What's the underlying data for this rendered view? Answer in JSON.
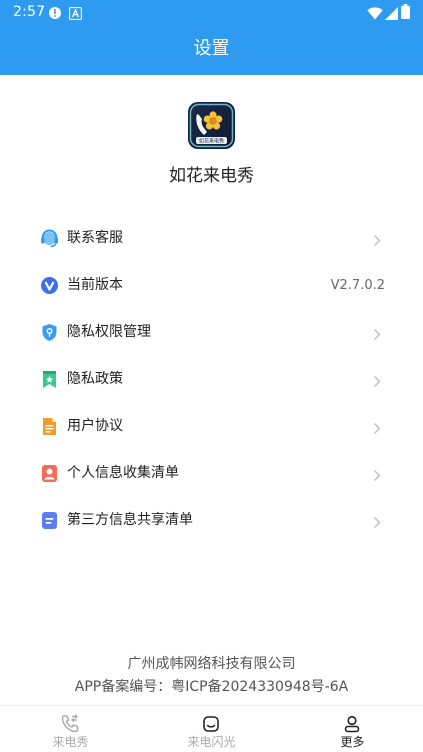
{
  "status_bar": {
    "time": "2:57"
  },
  "header": {
    "title": "设置"
  },
  "app": {
    "name": "如花来电秀",
    "logo_text": "如花来电秀"
  },
  "menu": [
    {
      "label": "联系客服",
      "icon": "headset-icon"
    },
    {
      "label": "当前版本",
      "icon": "version-icon",
      "value": "V2.7.0.2"
    },
    {
      "label": "隐私权限管理",
      "icon": "shield-icon"
    },
    {
      "label": "隐私政策",
      "icon": "bookmark-icon"
    },
    {
      "label": "用户协议",
      "icon": "document-icon"
    },
    {
      "label": "个人信息收集清单",
      "icon": "profile-card-icon"
    },
    {
      "label": "第三方信息共享清单",
      "icon": "list-card-icon"
    }
  ],
  "footer": {
    "company": "广州成帏网络科技有限公司",
    "icp": "APP备案编号：粤ICP备2024330948号-6A"
  },
  "tabs": [
    {
      "label": "来电秀",
      "icon": "phone-call-icon",
      "active": false
    },
    {
      "label": "来电闪光",
      "icon": "flash-face-icon",
      "active": false
    },
    {
      "label": "更多",
      "icon": "person-icon",
      "active": true
    }
  ],
  "colors": {
    "primary": "#2f9bf0",
    "text": "#222222",
    "muted": "#aaaaaa"
  }
}
